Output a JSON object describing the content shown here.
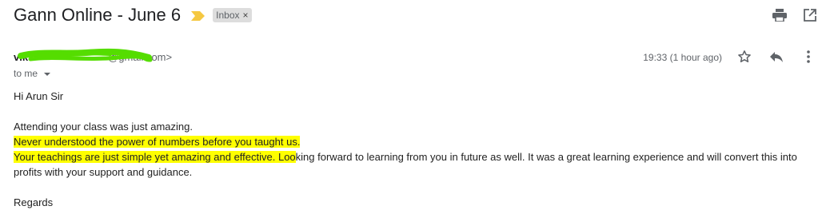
{
  "header": {
    "subject": "Gann Online - June 6",
    "label": "Inbox",
    "label_close": "×",
    "colors": {
      "importance": "#f5c842",
      "label_bg": "#dddddd"
    },
    "icons": [
      "print-icon",
      "open-in-new-window-icon"
    ]
  },
  "message": {
    "sender_name_visible": "vik",
    "sender_email_visible": "@gmail.com>",
    "to": "to me",
    "time": "19:33 (1 hour ago)",
    "action_icons": [
      "star-icon",
      "reply-icon",
      "more-vert-icon"
    ],
    "redaction_color": "#55dd00"
  },
  "body": {
    "greeting": "Hi Arun Sir",
    "line1": "Attending your class was just amazing.",
    "line2": "Never understood the power of numbers before you taught us.",
    "line3_highlight": "Your teachings are just simple yet amazing and effective. Loo",
    "line3_rest": "king forward to learning from you in future as well. It was a great learning experience and will convert this into profits with your support and guidance.",
    "closing": "Regards",
    "highlight_color": "#ffff00"
  }
}
